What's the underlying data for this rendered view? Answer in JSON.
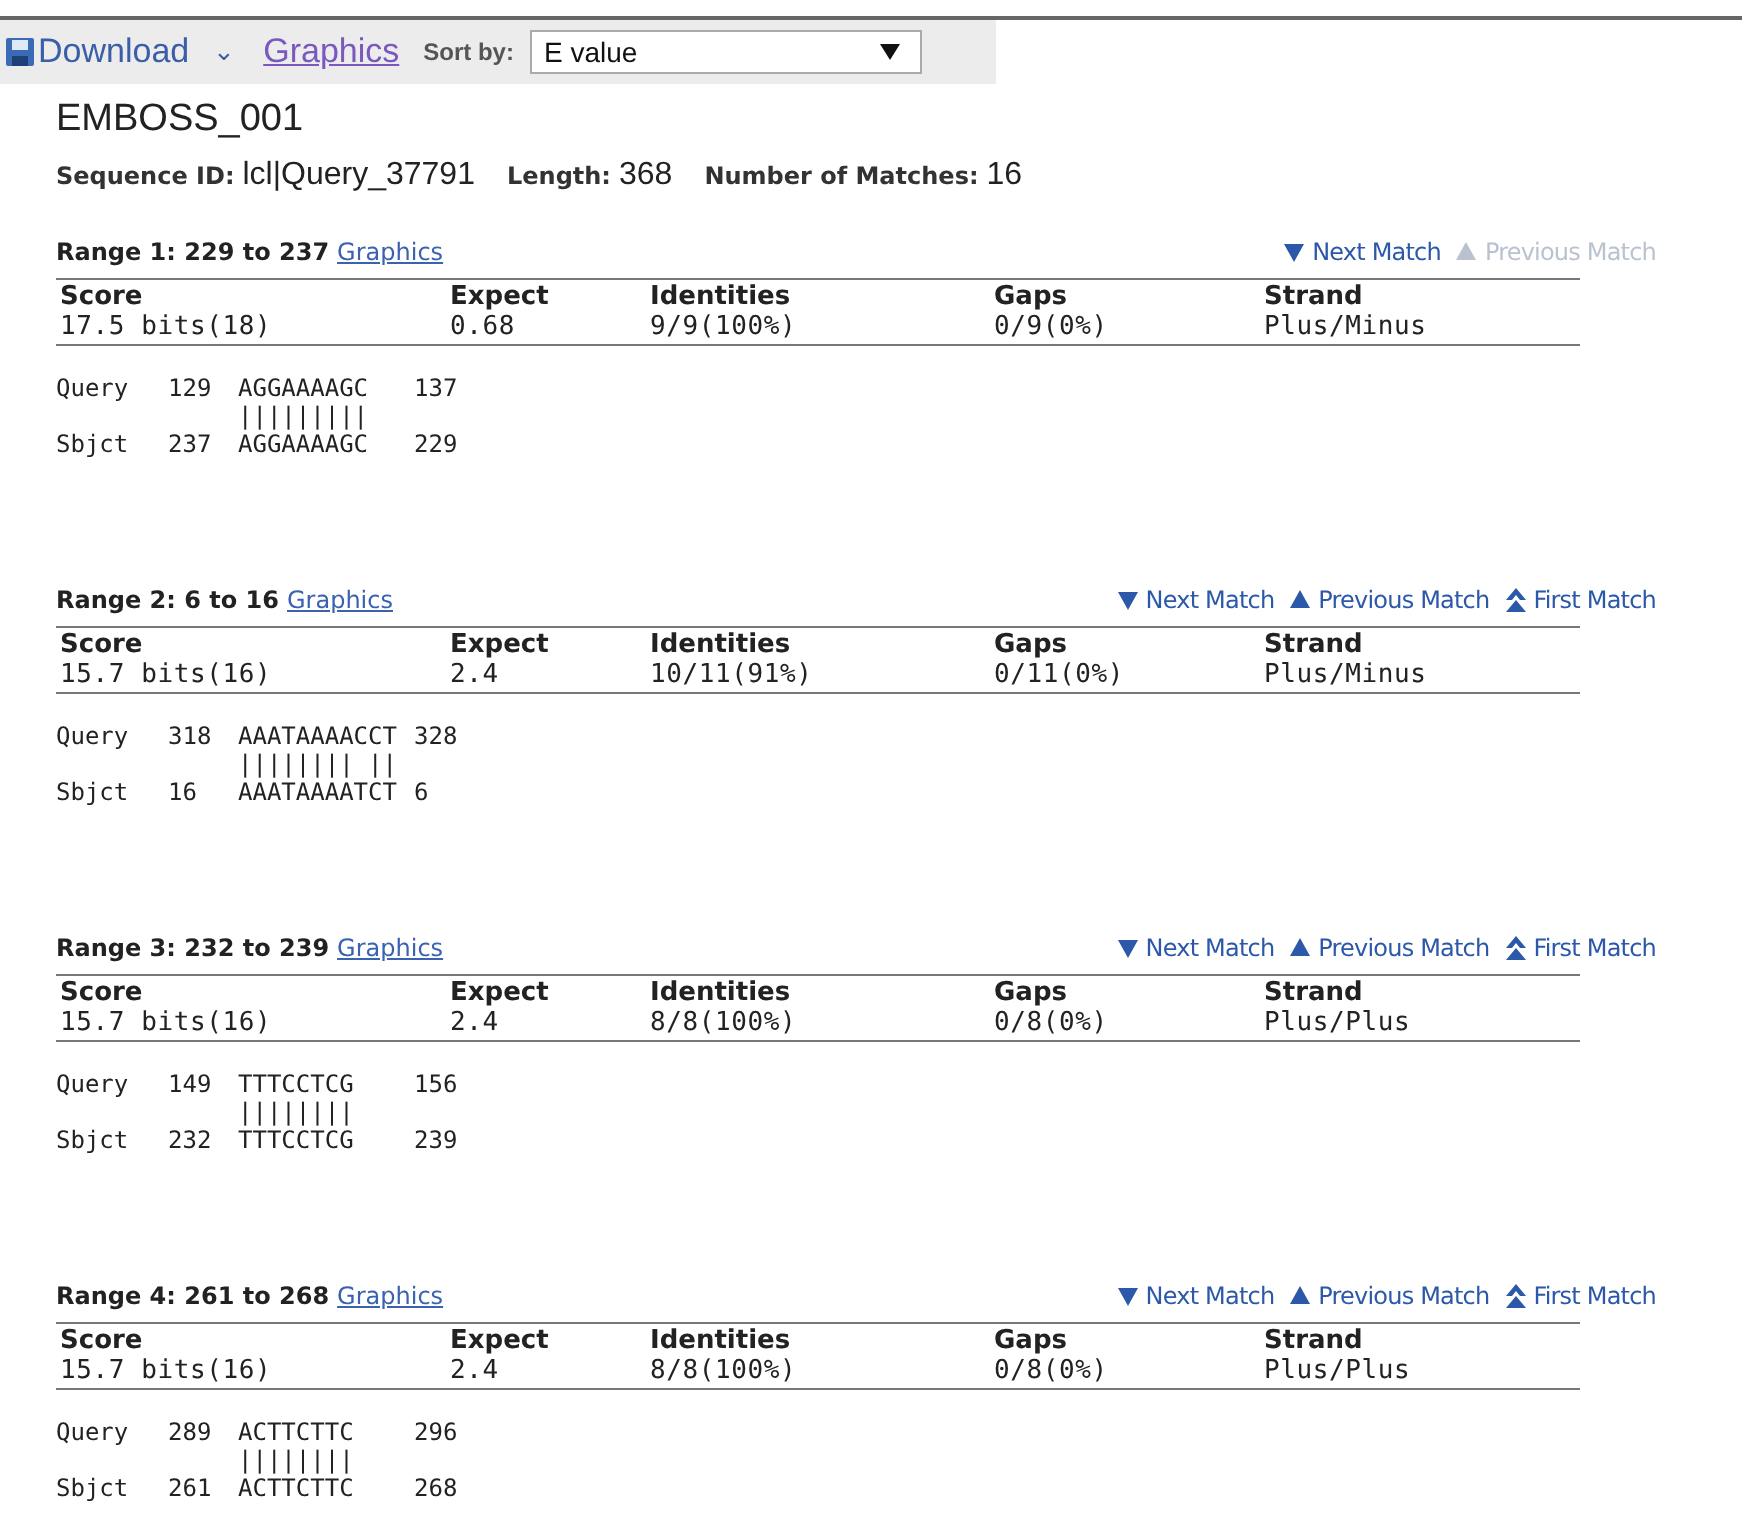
{
  "toolbar": {
    "download": "Download",
    "download_caret": "⌄",
    "graphics": "Graphics",
    "sort_label": "Sort by:",
    "sort_value": "E value"
  },
  "header": {
    "title": "EMBOSS_001",
    "fields": [
      {
        "label": "Sequence ID:",
        "value": "lcl|Query_37791"
      },
      {
        "label": "Length:",
        "value": "368"
      },
      {
        "label": "Number of Matches:",
        "value": "16"
      }
    ]
  },
  "ranges": [
    {
      "title": "Range 1: 229 to 237",
      "graphics": "Graphics",
      "nav": [
        {
          "kind": "next",
          "label": "Next Match",
          "disabled": false
        },
        {
          "kind": "previous",
          "label": "Previous Match",
          "disabled": true
        }
      ],
      "columns": [
        "Score",
        "Expect",
        "Identities",
        "Gaps",
        "Strand"
      ],
      "values": [
        "17.5 bits(18)",
        "0.68",
        "9/9(100%)",
        "0/9(0%)",
        "Plus/Minus"
      ],
      "alignment": {
        "query": [
          "Query",
          "129",
          "AGGAAAAGC",
          "137"
        ],
        "midline": "|||||||||",
        "sbjct": [
          "Sbjct",
          "237",
          "AGGAAAAGC",
          "229"
        ]
      }
    },
    {
      "title": "Range 2: 6 to 16",
      "graphics": "Graphics",
      "nav": [
        {
          "kind": "next",
          "label": "Next Match",
          "disabled": false
        },
        {
          "kind": "previous",
          "label": "Previous Match",
          "disabled": false
        },
        {
          "kind": "first",
          "label": "First Match",
          "disabled": false
        }
      ],
      "columns": [
        "Score",
        "Expect",
        "Identities",
        "Gaps",
        "Strand"
      ],
      "values": [
        "15.7 bits(16)",
        "2.4",
        "10/11(91%)",
        "0/11(0%)",
        "Plus/Minus"
      ],
      "alignment": {
        "query": [
          "Query",
          "318",
          "AAATAAAACCT",
          "328"
        ],
        "midline": "|||||||| ||",
        "sbjct": [
          "Sbjct",
          "16",
          "AAATAAAATCT",
          "6"
        ]
      }
    },
    {
      "title": "Range 3: 232 to 239",
      "graphics": "Graphics",
      "nav": [
        {
          "kind": "next",
          "label": "Next Match",
          "disabled": false
        },
        {
          "kind": "previous",
          "label": "Previous Match",
          "disabled": false
        },
        {
          "kind": "first",
          "label": "First Match",
          "disabled": false
        }
      ],
      "columns": [
        "Score",
        "Expect",
        "Identities",
        "Gaps",
        "Strand"
      ],
      "values": [
        "15.7 bits(16)",
        "2.4",
        "8/8(100%)",
        "0/8(0%)",
        "Plus/Plus"
      ],
      "alignment": {
        "query": [
          "Query",
          "149",
          "TTTCCTCG",
          "156"
        ],
        "midline": "||||||||",
        "sbjct": [
          "Sbjct",
          "232",
          "TTTCCTCG",
          "239"
        ]
      }
    },
    {
      "title": "Range 4: 261 to 268",
      "graphics": "Graphics",
      "nav": [
        {
          "kind": "next",
          "label": "Next Match",
          "disabled": false
        },
        {
          "kind": "previous",
          "label": "Previous Match",
          "disabled": false
        },
        {
          "kind": "first",
          "label": "First Match",
          "disabled": false
        }
      ],
      "columns": [
        "Score",
        "Expect",
        "Identities",
        "Gaps",
        "Strand"
      ],
      "values": [
        "15.7 bits(16)",
        "2.4",
        "8/8(100%)",
        "0/8(0%)",
        "Plus/Plus"
      ],
      "alignment": {
        "query": [
          "Query",
          "289",
          "ACTTCTTC",
          "296"
        ],
        "midline": "||||||||",
        "sbjct": [
          "Sbjct",
          "261",
          "ACTTCTTC",
          "268"
        ]
      }
    }
  ]
}
